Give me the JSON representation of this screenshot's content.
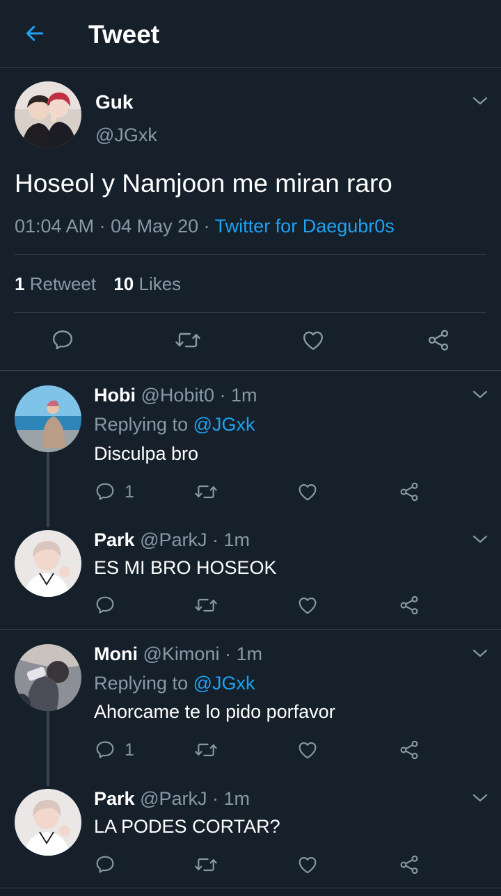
{
  "header": {
    "title": "Tweet",
    "back_icon": "arrow-left-icon"
  },
  "colors": {
    "background": "#15202b",
    "accent": "#1da1f2",
    "muted": "#8899a6",
    "divider": "#38444d"
  },
  "main_tweet": {
    "name": "Guk",
    "handle": "@JGxk",
    "text": "Hoseol y Namjoon me miran raro",
    "time": "01:04 AM",
    "sep1": " · ",
    "date": "04 May 20",
    "sep2": " · ",
    "source": "Twitter for Daegubr0s",
    "retweet_count": "1",
    "retweet_label": "Retweet",
    "like_count": "10",
    "like_label": "Likes"
  },
  "replies": [
    {
      "name": "Hobi",
      "handle": "@Hobit0",
      "time": " · 1m",
      "replying_prefix": "Replying to ",
      "replying_to": "@JGxk",
      "text": "Disculpa bro",
      "reply_count": "1"
    },
    {
      "name": "Park",
      "handle": "@ParkJ",
      "time": " · 1m",
      "text": "ES MI BRO HOSEOK",
      "reply_count": ""
    },
    {
      "name": "Moni",
      "handle": "@Kimoni",
      "time": " · 1m",
      "replying_prefix": "Replying to ",
      "replying_to": "@JGxk",
      "text": "Ahorcame te lo pido porfavor",
      "reply_count": "1"
    },
    {
      "name": "Park",
      "handle": "@ParkJ",
      "time": " · 1m",
      "text": "LA PODES CORTAR?",
      "reply_count": ""
    }
  ]
}
